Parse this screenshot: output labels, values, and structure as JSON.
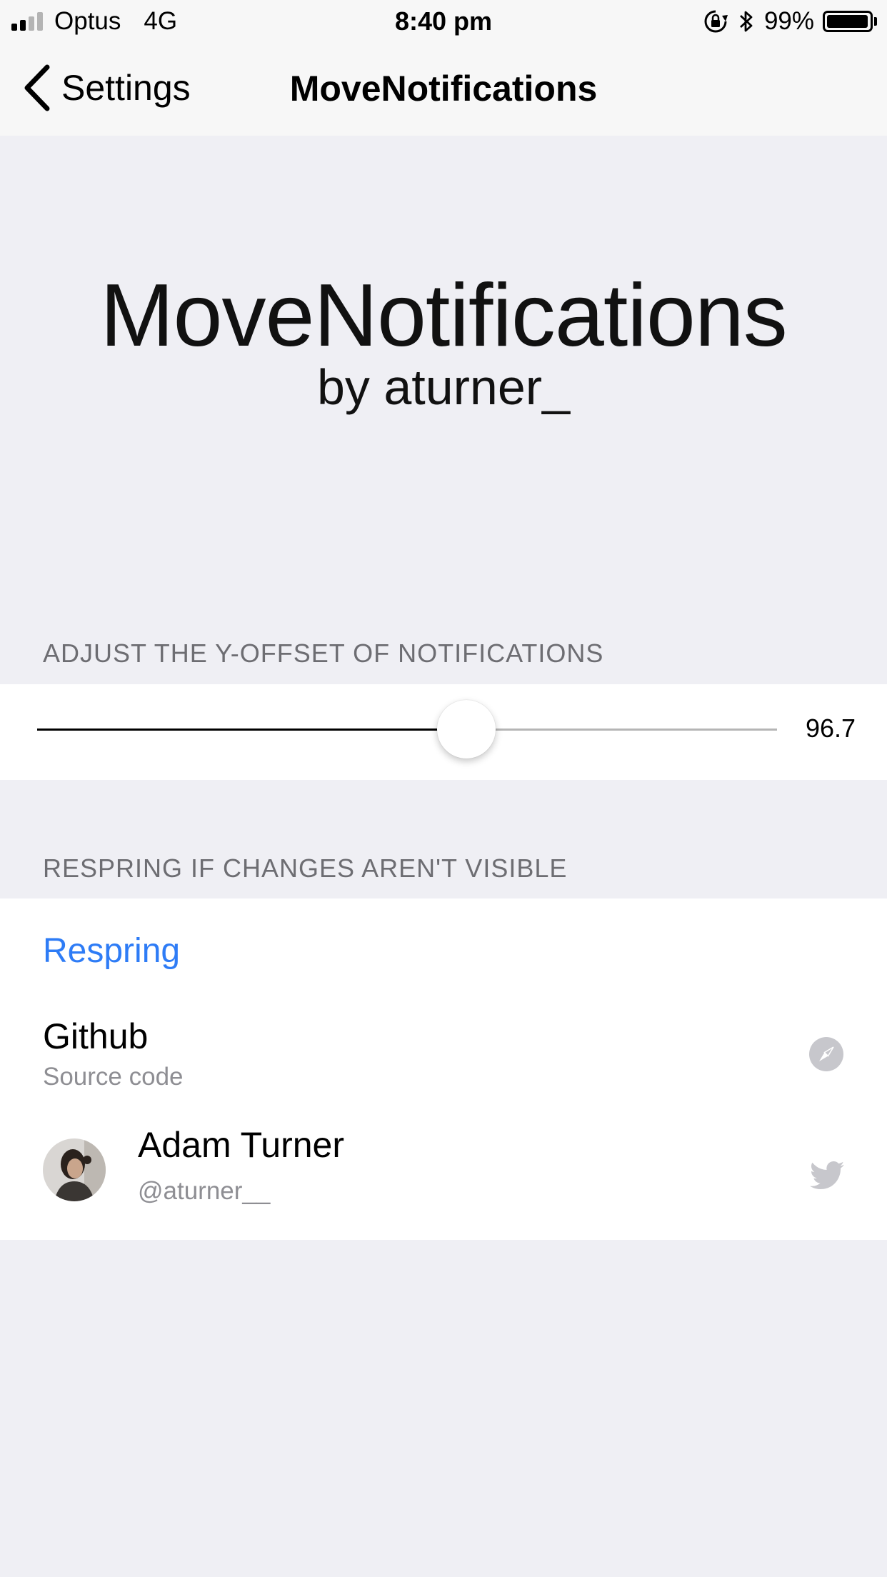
{
  "status_bar": {
    "carrier": "Optus",
    "network": "4G",
    "time": "8:40 pm",
    "battery": "99%",
    "battery_level": 0.99
  },
  "nav": {
    "back_label": "Settings",
    "title": "MoveNotifications"
  },
  "banner": {
    "title": "MoveNotifications",
    "subtitle": "by aturner_"
  },
  "offset_section": {
    "header": "ADJUST THE Y-OFFSET OF NOTIFICATIONS",
    "slider_value_label": "96.7",
    "slider_fraction": 0.58
  },
  "respring_section": {
    "header": "RESPRING IF CHANGES AREN'T VISIBLE",
    "respring_label": "Respring",
    "github": {
      "title": "Github",
      "subtitle": "Source code",
      "icon": "compass-icon"
    },
    "author": {
      "name": "Adam Turner",
      "handle": "@aturner__",
      "icon": "twitter-icon"
    }
  },
  "colors": {
    "background": "#efeff4",
    "accent": "#2e7cf6",
    "secondary_text": "#8e8e93",
    "section_header": "#6d6d72"
  }
}
